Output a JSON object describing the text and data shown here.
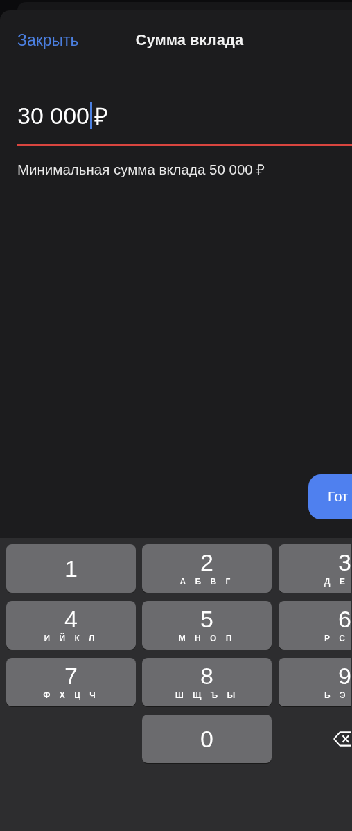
{
  "header": {
    "close": "Закрыть",
    "title": "Сумма вклада"
  },
  "amount": {
    "value": "30 000",
    "currency": "₽",
    "focused": true,
    "error": true
  },
  "hint": "Минимальная сумма вклада 50 000 ₽",
  "done_button": "Гот",
  "keypad": [
    {
      "kind": "digit",
      "digit": "1"
    },
    {
      "kind": "digit",
      "digit": "2",
      "letters": "А Б В Г"
    },
    {
      "kind": "digit",
      "digit": "3",
      "letters": "Д Е"
    },
    {
      "kind": "digit",
      "digit": "4",
      "letters": "И Й К Л"
    },
    {
      "kind": "digit",
      "digit": "5",
      "letters": "М Н О П"
    },
    {
      "kind": "digit",
      "digit": "6",
      "letters": "Р С"
    },
    {
      "kind": "digit",
      "digit": "7",
      "letters": "Ф Х Ц Ч"
    },
    {
      "kind": "digit",
      "digit": "8",
      "letters": "Ш Щ Ъ Ы"
    },
    {
      "kind": "digit",
      "digit": "9",
      "letters": "Ь Э"
    },
    {
      "kind": "blank"
    },
    {
      "kind": "digit",
      "digit": "0"
    },
    {
      "kind": "delete"
    }
  ]
}
